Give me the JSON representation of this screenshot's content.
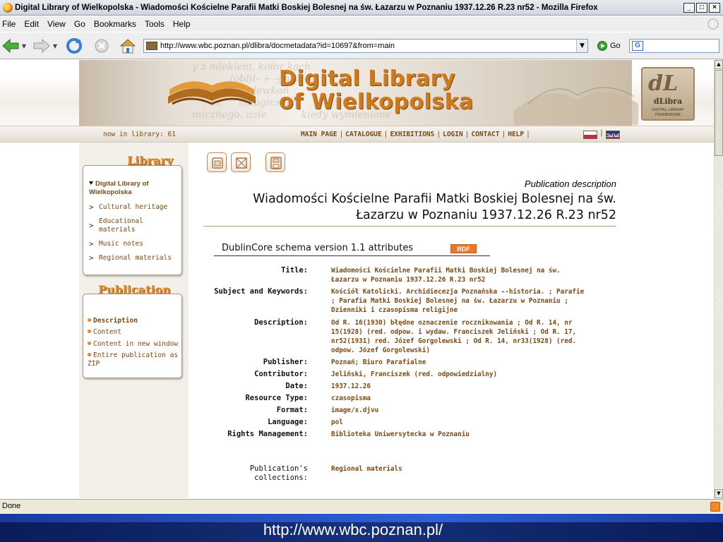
{
  "window": {
    "title": "Digital Library of Wielkopolska - Wiadomości Kościelne Parafii Matki Boskiej Bolesnej na św. Łazarzu w Poznaniu 1937.12.26 R.23 nr52 - Mozilla Firefox",
    "controls": [
      "_",
      "□",
      "×"
    ]
  },
  "menu": [
    "File",
    "Edit",
    "View",
    "Go",
    "Bookmarks",
    "Tools",
    "Help"
  ],
  "toolbar": {
    "url": "http://www.wbc.poznan.pl/dlibra/docmetadata?id=10697&from=main",
    "go_label": "Go",
    "search_engine_icon": "G"
  },
  "site": {
    "title_line1": "Digital Library",
    "title_line2": "of Wielkopolska",
    "badge_word": "dLibra",
    "badge_sub": "DIGITAL LIBRARY FRAMEWORK",
    "in_library": "now in library: 61",
    "nav": [
      "MAIN PAGE",
      "CATALOGUE",
      "EXHIBITIONS",
      "LOGIN",
      "CONTACT",
      "HELP"
    ]
  },
  "sidebar": {
    "library_heading": "Library",
    "library_root": "Digital Library of Wielkopolska",
    "library_items": [
      "Cultural heritage",
      "Educational materials",
      "Music notes",
      "Regional materials"
    ],
    "publication_heading": "Publication",
    "publication_items": [
      "Description",
      "Content",
      "Content in new window",
      "Entire publication as ZIP"
    ]
  },
  "main": {
    "section_label": "Publication description",
    "title": "Wiadomości Kościelne Parafii Matki Boskiej Bolesnej na św. Łazarzu w Poznaniu 1937.12.26 R.23 nr52",
    "schema_heading": "DublinCore schema version 1.1 attributes",
    "rdf_label": "RDF",
    "metadata": [
      {
        "label": "Title:",
        "value": "Wiadomości Kościelne Parafii Matki Boskiej Bolesnej na św. Łazarzu w Poznaniu 1937.12.26 R.23 nr52"
      },
      {
        "label": "Subject and Keywords:",
        "value": "Kościół Katolicki. Archidiecezja Poznańska --historia. ; Parafie ; Parafia Matki Boskiej Bolesnej na św. Łazarzu w Poznaniu ; Dzienniki i czasopisma religijne"
      },
      {
        "label": "Description:",
        "value": "Od R. 16(1930) błędne oznaczenie rocznikowania ; Od R. 14, nr 15(1928) (red. odpow. i wydaw. Franciszek Jeliński ; Od R. 17, nr52(1931) red. Józef Gorgolewski ; Od R. 14, nr33(1928) (red. odpow. Józef Gorgolewski)"
      },
      {
        "label": "Publisher:",
        "value": "Poznań; Biuro Parafialne"
      },
      {
        "label": "Contributor:",
        "value": "Jeliński, Franciszek (red. odpowiedzialny)"
      },
      {
        "label": "Date:",
        "value": "1937.12.26"
      },
      {
        "label": "Resource Type:",
        "value": "czasopisma"
      },
      {
        "label": "Format:",
        "value": "image/x.djvu"
      },
      {
        "label": "Language:",
        "value": "pol"
      },
      {
        "label": "Rights Management:",
        "value": "Biblioteka Uniwersytecka w Poznaniu"
      }
    ],
    "collections_label": "Publication's collections:",
    "collections_value": "Regional materials"
  },
  "status": {
    "text": "Done"
  },
  "footer": {
    "url": "http://www.wbc.poznan.pl/"
  }
}
